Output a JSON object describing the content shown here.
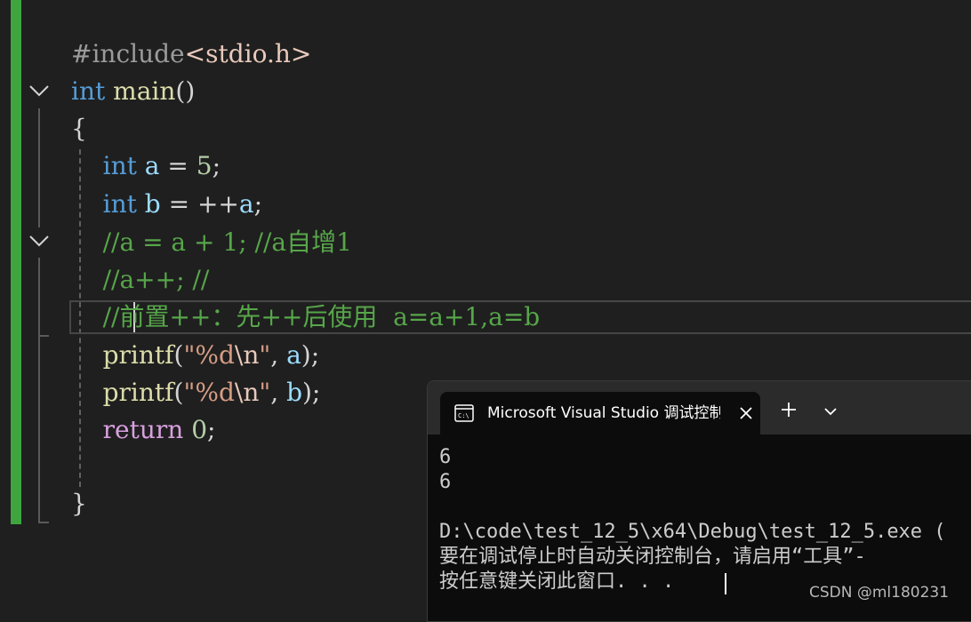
{
  "editor": {
    "lines": [
      {
        "tokens": [
          {
            "text": "#include",
            "cls": "pre"
          },
          {
            "text": "<stdio.h>",
            "cls": "inc"
          }
        ]
      },
      {
        "tokens": [
          {
            "text": "int",
            "cls": "kw"
          },
          {
            "text": " ",
            "cls": "punc"
          },
          {
            "text": "main",
            "cls": "fn"
          },
          {
            "text": "()",
            "cls": "punc"
          }
        ]
      },
      {
        "tokens": [
          {
            "text": "{",
            "cls": "punc"
          }
        ]
      },
      {
        "tokens": [
          {
            "text": "    ",
            "cls": "punc"
          },
          {
            "text": "int",
            "cls": "kw"
          },
          {
            "text": " ",
            "cls": "punc"
          },
          {
            "text": "a",
            "cls": "var"
          },
          {
            "text": " = ",
            "cls": "punc"
          },
          {
            "text": "5",
            "cls": "num"
          },
          {
            "text": ";",
            "cls": "punc"
          }
        ]
      },
      {
        "tokens": [
          {
            "text": "    ",
            "cls": "punc"
          },
          {
            "text": "int",
            "cls": "kw"
          },
          {
            "text": " ",
            "cls": "punc"
          },
          {
            "text": "b",
            "cls": "var"
          },
          {
            "text": " = ++",
            "cls": "punc"
          },
          {
            "text": "a",
            "cls": "var"
          },
          {
            "text": ";",
            "cls": "punc"
          }
        ]
      },
      {
        "tokens": [
          {
            "text": "    //a = a + 1; //a自增1",
            "cls": "cmt"
          }
        ]
      },
      {
        "tokens": [
          {
            "text": "    //a++; //",
            "cls": "cmt"
          }
        ]
      },
      {
        "tokens": [
          {
            "text": "    //前置++：先++后使用  a=a+1,a=b",
            "cls": "cmt"
          }
        ]
      },
      {
        "tokens": [
          {
            "text": "    ",
            "cls": "punc"
          },
          {
            "text": "printf",
            "cls": "fn"
          },
          {
            "text": "(",
            "cls": "punc"
          },
          {
            "text": "\"%d",
            "cls": "str"
          },
          {
            "text": "\\n",
            "cls": "esc"
          },
          {
            "text": "\"",
            "cls": "str"
          },
          {
            "text": ", ",
            "cls": "punc"
          },
          {
            "text": "a",
            "cls": "var"
          },
          {
            "text": ");",
            "cls": "punc"
          }
        ]
      },
      {
        "tokens": [
          {
            "text": "    ",
            "cls": "punc"
          },
          {
            "text": "printf",
            "cls": "fn"
          },
          {
            "text": "(",
            "cls": "punc"
          },
          {
            "text": "\"%d",
            "cls": "str"
          },
          {
            "text": "\\n",
            "cls": "esc"
          },
          {
            "text": "\"",
            "cls": "str"
          },
          {
            "text": ", ",
            "cls": "punc"
          },
          {
            "text": "b",
            "cls": "var"
          },
          {
            "text": ");",
            "cls": "punc"
          }
        ]
      },
      {
        "tokens": [
          {
            "text": "    ",
            "cls": "punc"
          },
          {
            "text": "return",
            "cls": "ctrl"
          },
          {
            "text": " ",
            "cls": "punc"
          },
          {
            "text": "0",
            "cls": "num"
          },
          {
            "text": ";",
            "cls": "punc"
          }
        ]
      },
      {
        "tokens": []
      },
      {
        "tokens": [
          {
            "text": "}",
            "cls": "punc"
          }
        ]
      }
    ]
  },
  "console": {
    "tab_title": "Microsoft Visual Studio 调试控制台",
    "tab_icon": "terminal-icon",
    "output": [
      "6",
      "6",
      "",
      "D:\\code\\test_12_5\\x64\\Debug\\test_12_5.exe (",
      "要在调试停止时自动关闭控制台，请启用“工具”-",
      "按任意键关闭此窗口. . ."
    ]
  },
  "watermark": "CSDN @ml180231",
  "colors": {
    "background": "#1f1f1f",
    "change_bar": "#3fa63f",
    "keyword": "#569cd6",
    "function": "#dcdcaa",
    "variable": "#9cdcfe",
    "number": "#b5cea8",
    "string": "#d69d85",
    "comment": "#57a64a",
    "control": "#d8a0df"
  }
}
